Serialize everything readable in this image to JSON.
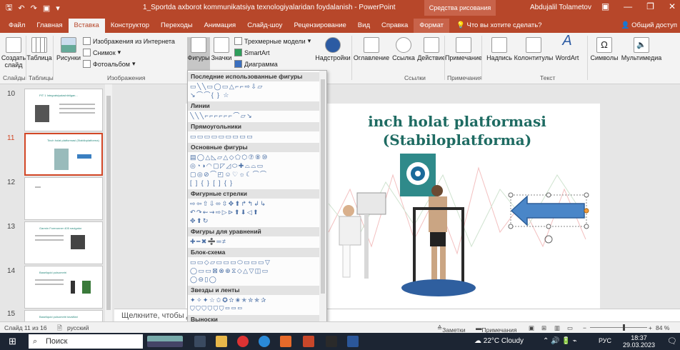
{
  "window": {
    "title": "1_Sportda axborot kommunikatsiya texnologiyalaridan foydalanish  -  PowerPoint",
    "context_tab": "Средства рисования",
    "user": "Abdujalil Tolametov"
  },
  "tabs": [
    "Файл",
    "Главная",
    "Вставка",
    "Конструктор",
    "Переходы",
    "Анимация",
    "Слайд-шоу",
    "Рецензирование",
    "Вид",
    "Справка",
    "Формат"
  ],
  "tell_me": "Что вы хотите сделать?",
  "share": "Общий доступ",
  "ribbon": {
    "new_slide": "Создать слайд",
    "table": "Таблица",
    "pictures": "Рисунки",
    "online_pictures": "Изображения из Интернета",
    "screenshot": "Снимок",
    "photo_album": "Фотоальбом",
    "shapes": "Фигуры",
    "icons": "Значки",
    "models_3d": "Трехмерные модели",
    "smartart": "SmartArt",
    "chart": "Диаграмма",
    "addins": "Надстройки",
    "zoom": "Оглавление",
    "link": "Ссылка",
    "action": "Действие",
    "comment": "Примечание",
    "textbox": "Надпись",
    "header_footer": "Колонтитулы",
    "wordart": "WordArt",
    "symbols": "Символы",
    "media": "Мультимедиа",
    "groups": {
      "slides": "Слайды",
      "tables": "Таблицы",
      "images": "Изображения",
      "links": "Ссылки",
      "comments": "Примечания",
      "text": "Текст"
    }
  },
  "shapes_menu": {
    "sections": [
      {
        "name": "Последние использованные фигуры",
        "rows": [
          "▭╲╲▭◯▭△⌐⌐⇨⇩▱",
          "↘⌒⌒{ } ☆"
        ]
      },
      {
        "name": "Линии",
        "rows": [
          "╲╲╲⌐⌐⌐⌐⌐⌐⌒▱↘"
        ]
      },
      {
        "name": "Прямоугольники",
        "rows": [
          "▭▭▭▭▭▭▭▭▭"
        ]
      },
      {
        "name": "Основные фигуры",
        "rows": [
          "▤◯△◺▱△◇⬠⬡⑦⑧⑩",
          "◎◔◑◠▢◸◿⬭✚⌓⌓▭",
          "▢◎⊘⌒◰☺♡☼☾⌒⌒",
          "[ ] { } [ ] { }"
        ]
      },
      {
        "name": "Фигурные стрелки",
        "rows": [
          "⇨⇦⇧⇩⬄⇳✥⬆↱↰↲↳",
          "↶↷⇜⇝⇨▷⊳⬆⬇◁⬆",
          "✥⬆↻"
        ]
      },
      {
        "name": "Фигуры для уравнений",
        "rows": [
          "✚━✖➗═≠"
        ]
      },
      {
        "name": "Блок-схема",
        "rows": [
          "▭▭◇▱▭▭▭⬭▭▭▭▽",
          "◯▭▭⊠⊗⊕⧖◇△▽◫▭",
          "◯⊖▯◯"
        ]
      },
      {
        "name": "Звезды и ленты",
        "rows": [
          "✦✧✦☆✩✪✫✬✭✮✯✰",
          "⛉⛉⛉⛉⛉⛉▭▭▭"
        ]
      },
      {
        "name": "Выноски",
        "rows": []
      }
    ]
  },
  "thumbnails": [
    {
      "num": "10",
      "title": "PIT 1 Integratsiyalashtirilgan..."
    },
    {
      "num": "11",
      "title": "Tinch holat platformasi (Stabiloplatforma)"
    },
    {
      "num": "12",
      "title": ""
    },
    {
      "num": "13",
      "title": "Garmin Forerunner 405 navigator"
    },
    {
      "num": "14",
      "title": "Baseliquid pulsometri"
    },
    {
      "num": "15",
      "title": "Baseliquid pulsometri tavsiflari"
    }
  ],
  "slide": {
    "title": "inch holat platformasi\n(Stabiloplatforma)"
  },
  "notes_placeholder": "Щелкните, чтобы д",
  "status": {
    "slide_info": "Слайд 11 из 16",
    "language": "русский",
    "notes": "Заметки",
    "comments": "Примечания",
    "zoom": "84 %"
  },
  "taskbar": {
    "search": "Поиск",
    "weather": "22°C  Cloudy",
    "lang": "РУС",
    "time": "18:37",
    "date": "29.03.2023"
  }
}
